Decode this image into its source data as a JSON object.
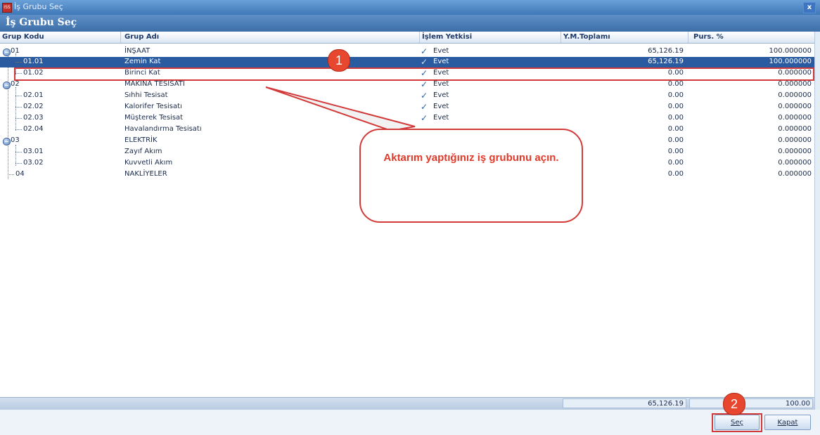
{
  "window": {
    "title": "İş Grubu Seç",
    "app_icon": "app-icon",
    "close_glyph": "x"
  },
  "header": {
    "title": "İş Grubu Seç"
  },
  "columns": {
    "code": "Grup Kodu",
    "name": "Grup Adı",
    "auth": "İşlem Yetkisi",
    "total": "Y.M.Toplamı",
    "pct": "Purs. %"
  },
  "rows": [
    {
      "code": "01",
      "name": "İNŞAAT",
      "auth": "Evet",
      "total": "65,126.19",
      "pct": "100.000000"
    },
    {
      "code": "01.01",
      "name": "Zemin Kat",
      "auth": "Evet",
      "total": "65,126.19",
      "pct": "100.000000"
    },
    {
      "code": "01.02",
      "name": "Birinci Kat",
      "auth": "Evet",
      "total": "0.00",
      "pct": "0.000000"
    },
    {
      "code": "02",
      "name": "MAKİNA TESİSATI",
      "auth": "Evet",
      "total": "0.00",
      "pct": "0.000000"
    },
    {
      "code": "02.01",
      "name": "Sıhhi Tesisat",
      "auth": "Evet",
      "total": "0.00",
      "pct": "0.000000"
    },
    {
      "code": "02.02",
      "name": "Kalorifer Tesisatı",
      "auth": "Evet",
      "total": "0.00",
      "pct": "0.000000"
    },
    {
      "code": "02.03",
      "name": "Müşterek Tesisat",
      "auth": "Evet",
      "total": "0.00",
      "pct": "0.000000"
    },
    {
      "code": "02.04",
      "name": "Havalandırma Tesisatı",
      "auth": "",
      "total": "0.00",
      "pct": "0.000000"
    },
    {
      "code": "03",
      "name": "ELEKTRİK",
      "auth": "",
      "total": "0.00",
      "pct": "0.000000"
    },
    {
      "code": "03.01",
      "name": "Zayıf Akım",
      "auth": "",
      "total": "0.00",
      "pct": "0.000000"
    },
    {
      "code": "03.02",
      "name": "Kuvvetli Akım",
      "auth": "",
      "total": "0.00",
      "pct": "0.000000"
    },
    {
      "code": "04",
      "name": "NAKLİYELER",
      "auth": "",
      "total": "0.00",
      "pct": "0.000000"
    }
  ],
  "selected_row_index": 1,
  "totals": {
    "total": "65,126.19",
    "pct": "100.00"
  },
  "buttons": {
    "select": "Seç",
    "close": "Kapat"
  },
  "annotations": {
    "marker_1": "1",
    "marker_2": "2",
    "callout": "Aktarım yaptığınız iş grubunu açın."
  },
  "colors": {
    "highlight_red": "#d23a3a",
    "selected_row": "#2a5aa0",
    "header_blue": "#3c6ea8"
  }
}
